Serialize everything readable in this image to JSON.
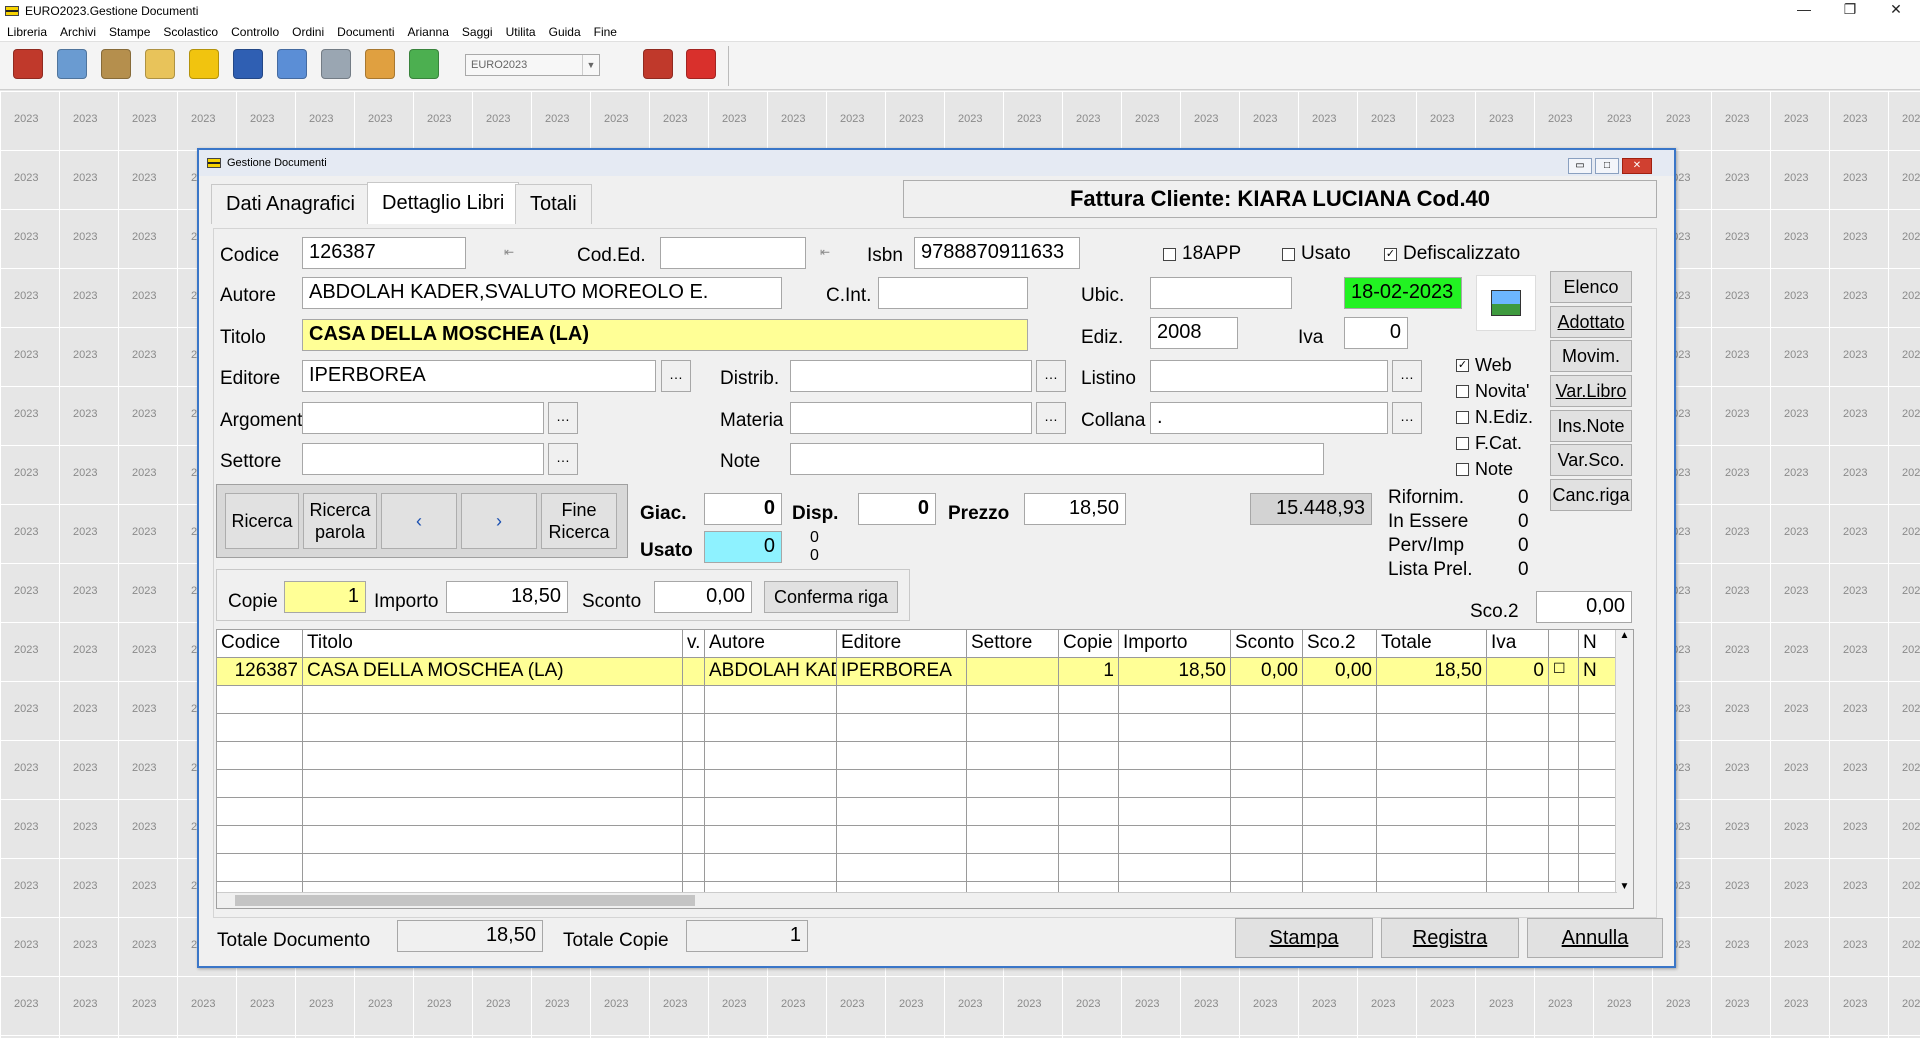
{
  "window": {
    "title": "EURO2023.Gestione Documenti",
    "controls": {
      "minimize": "—",
      "restore": "❐",
      "close": "✕"
    }
  },
  "menu": [
    "Libreria",
    "Archivi",
    "Stampe",
    "Scolastico",
    "Controllo",
    "Ordini",
    "Documenti",
    "Arianna",
    "Saggi",
    "Utilita",
    "Guida",
    "Fine"
  ],
  "toolbar": {
    "year_combo": "EURO2023",
    "icons": [
      "books-icon",
      "search-doc-icon",
      "users-icon",
      "notes-icon",
      "edit-icon",
      "calendar-icon",
      "find-icon",
      "printer-icon",
      "package-icon",
      "download-icon",
      "person-icon",
      "power-icon"
    ],
    "colors": [
      "#c0392b",
      "#6a9bd1",
      "#b58f4d",
      "#e8c35a",
      "#f1c40f",
      "#2f5fb3",
      "#5b8ed6",
      "#9aa6b2",
      "#e0a040",
      "#4caf50",
      "#c0392b",
      "#d9302c"
    ]
  },
  "watermark": "2023",
  "dialog": {
    "title": "Gestione Documenti",
    "tabs": [
      "Dati Anagrafici",
      "Dettaglio Libri",
      "Totali"
    ],
    "headline": "Fattura Cliente: KIARA LUCIANA Cod.40",
    "labels": {
      "codice": "Codice",
      "cod_ed": "Cod.Ed.",
      "isbn": "Isbn",
      "autore": "Autore",
      "c_int": "C.Int.",
      "ubic": "Ubic.",
      "titolo": "Titolo",
      "ediz": "Ediz.",
      "iva": "Iva",
      "editore": "Editore",
      "distrib": "Distrib.",
      "listino": "Listino",
      "argomento": "Argomento",
      "materia": "Materia",
      "collana": "Collana",
      "settore": "Settore",
      "note": "Note",
      "giac": "Giac.",
      "disp": "Disp.",
      "prezzo": "Prezzo",
      "usato": "Usato",
      "copie": "Copie",
      "importo": "Importo",
      "sconto": "Sconto",
      "sco2": "Sco.2",
      "rifornim": "Rifornim.",
      "in_essere": "In Essere",
      "perv_imp": "Perv/Imp",
      "lista_prel": "Lista Prel.",
      "totale_documento": "Totale Documento",
      "totale_copie": "Totale Copie"
    },
    "checks_top": [
      {
        "label": "18APP",
        "checked": false
      },
      {
        "label": "Usato",
        "checked": false
      },
      {
        "label": "Defiscalizzato",
        "checked": true
      }
    ],
    "checks_side": [
      {
        "label": "Web",
        "checked": true
      },
      {
        "label": "Novita'",
        "checked": false
      },
      {
        "label": "N.Ediz.",
        "checked": false
      },
      {
        "label": "F.Cat.",
        "checked": false
      },
      {
        "label": "Note",
        "checked": false
      }
    ],
    "values": {
      "codice": "126387",
      "cod_ed": "",
      "isbn": "9788870911633",
      "autore": "ABDOLAH KADER,SVALUTO MOREOLO E.",
      "c_int": "",
      "ubic": "",
      "date": "18-02-2023",
      "titolo": "CASA DELLA MOSCHEA (LA)",
      "ediz": "2008",
      "iva": "0",
      "editore": "IPERBOREA",
      "distrib": "",
      "listino": "",
      "argomento": "",
      "materia": "",
      "collana": ".",
      "settore": "",
      "note": "",
      "giac": "0",
      "disp": "0",
      "prezzo": "18,50",
      "total_value": "15.448,93",
      "usato": "0",
      "usato_sub1": "0",
      "usato_sub2": "0",
      "rifornim": "0",
      "in_essere": "0",
      "perv_imp": "0",
      "lista_prel": "0",
      "copie": "1",
      "importo": "18,50",
      "sconto": "0,00",
      "sco2": "0,00",
      "totale_documento": "18,50",
      "totale_copie": "1"
    },
    "side_buttons": [
      "Elenco",
      "Adottato",
      "Movim.",
      "Var.Libro",
      "Ins.Note",
      "Var.Sco.",
      "Canc.riga"
    ],
    "nav_buttons": {
      "ricerca": "Ricerca",
      "ricerca_parola_1": "Ricerca",
      "ricerca_parola_2": "parola",
      "prev": "‹",
      "next": "›",
      "fine_ricerca_1": "Fine",
      "fine_ricerca_2": "Ricerca"
    },
    "conferma_riga": "Conferma riga",
    "table": {
      "headers": [
        "Codice",
        "Titolo",
        "v.",
        "Autore",
        "Editore",
        "Settore",
        "Copie",
        "Importo",
        "Sconto",
        "Sco.2",
        "Totale",
        "Iva",
        "",
        "N"
      ],
      "rows": [
        [
          "126387",
          "CASA DELLA MOSCHEA (LA)",
          "",
          "ABDOLAH KADER",
          "IPERBOREA",
          "",
          "1",
          "18,50",
          "0,00",
          "0,00",
          "18,50",
          "0",
          "☐",
          "N"
        ]
      ]
    },
    "bottom_buttons": {
      "stampa": "Stampa",
      "registra": "Registra",
      "annulla": "Annulla"
    }
  }
}
